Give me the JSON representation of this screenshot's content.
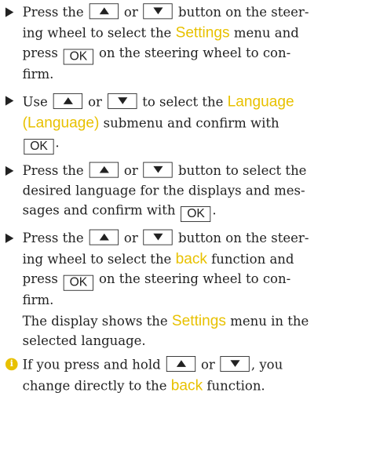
{
  "keys": {
    "up_icon": "triangle-up",
    "down_icon": "triangle-down",
    "ok": "OK"
  },
  "colors": {
    "highlight": "#e8c100",
    "text": "#222222"
  },
  "step1": {
    "l1a": "Press the",
    "l1b": "or",
    "l1c": "button on the steer-",
    "l2a": "ing wheel to select the",
    "l2hl": "Settings",
    "l2b": "menu and",
    "l3a": "press",
    "l3b": "on the steering wheel to con-",
    "l4": "firm."
  },
  "step2": {
    "l1a": "Use",
    "l1b": "or",
    "l1c": "to select the",
    "l1hl": "Language",
    "l2hl": "(Language)",
    "l2b": "submenu and confirm with",
    "l3b": "."
  },
  "step3": {
    "l1a": "Press the",
    "l1b": "or",
    "l1c": "button to select the",
    "l2": "desired language for the displays and mes-",
    "l3a": "sages and confirm with",
    "l3b": "."
  },
  "step4": {
    "l1a": "Press the",
    "l1b": "or",
    "l1c": "button on the steer-",
    "l2a": "ing wheel to select the",
    "l2hl": "back",
    "l2b": "function and",
    "l3a": "press",
    "l3b": "on the steering wheel to con-",
    "l4": "firm.",
    "l5a": "The display shows the",
    "l5hl": "Settings",
    "l5b": "menu in the",
    "l6": "selected language."
  },
  "note": {
    "icon": "i",
    "l1a": "If you press and hold",
    "l1b": "or",
    "l1c": ",",
    "l1d": "you",
    "l2a": "change directly to the",
    "l2hl": "back",
    "l2b": "function."
  }
}
